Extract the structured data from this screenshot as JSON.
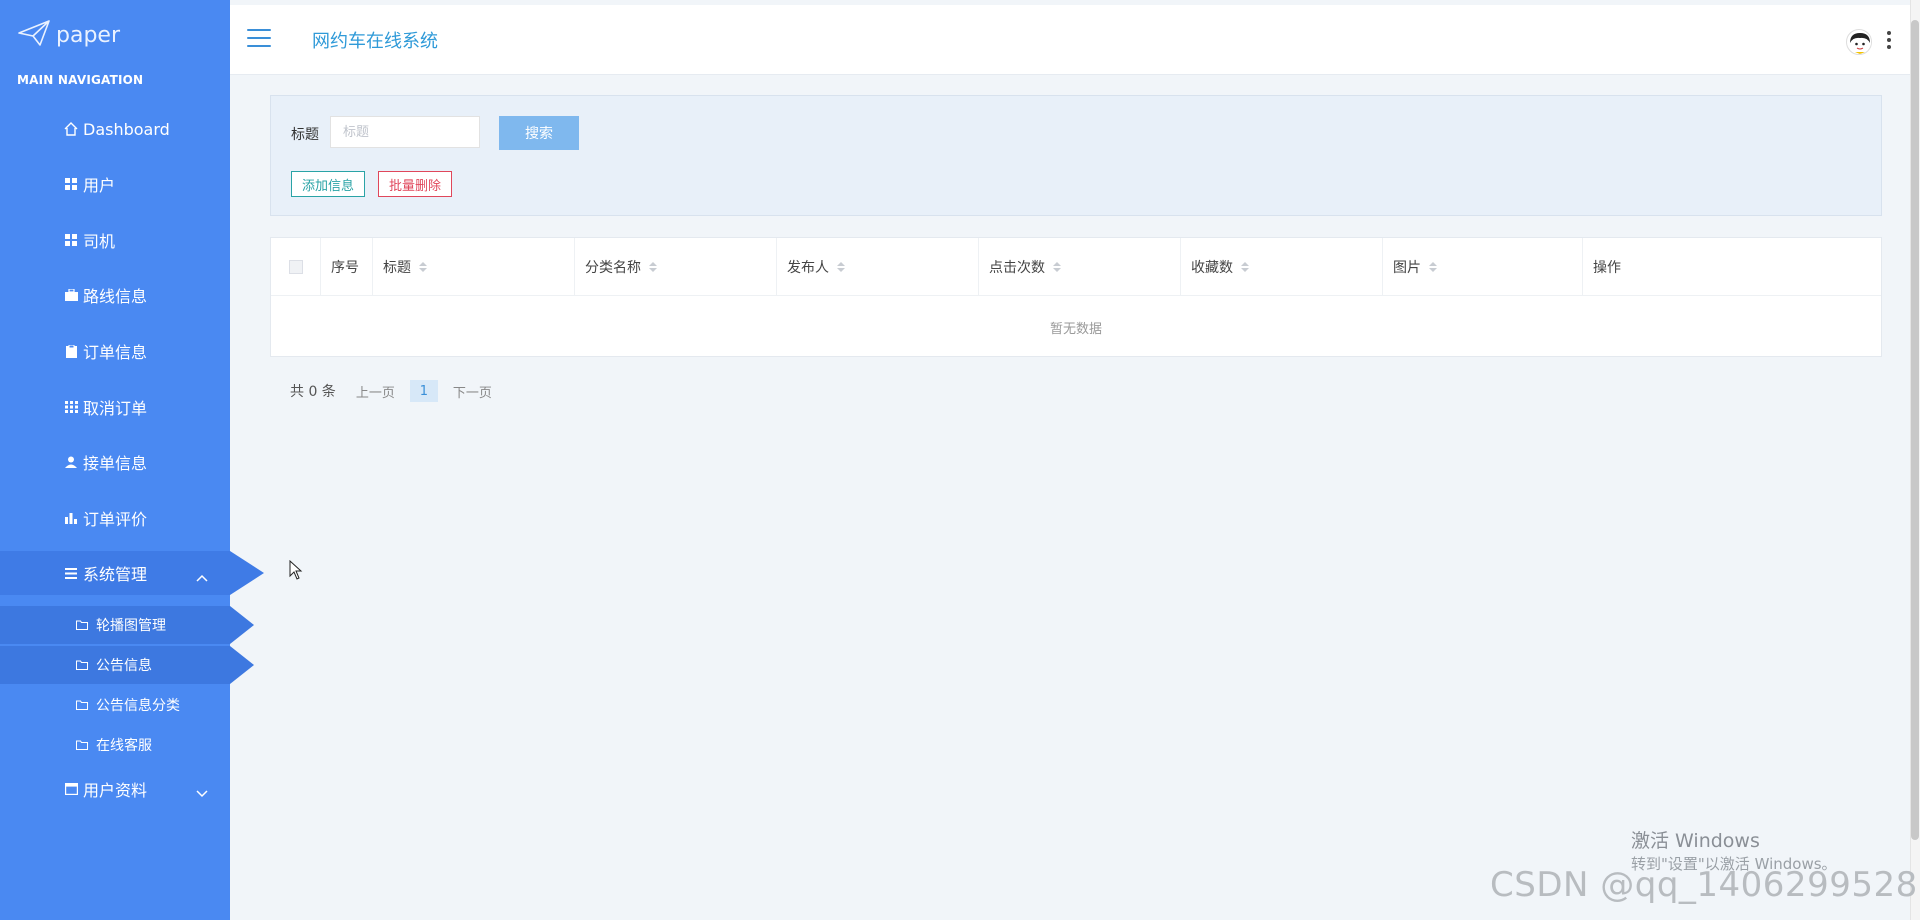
{
  "sidebar": {
    "logo": "paper",
    "section_title": "MAIN NAVIGATION",
    "items": [
      {
        "label": "Dashboard",
        "icon": "home-icon"
      },
      {
        "label": "用户",
        "icon": "grid-icon"
      },
      {
        "label": "司机",
        "icon": "grid-icon"
      },
      {
        "label": "路线信息",
        "icon": "briefcase-icon"
      },
      {
        "label": "订单信息",
        "icon": "clipboard-icon"
      },
      {
        "label": "取消订单",
        "icon": "table-icon"
      },
      {
        "label": "接单信息",
        "icon": "user-icon"
      },
      {
        "label": "订单评价",
        "icon": "bar-chart-icon"
      },
      {
        "label": "系统管理",
        "icon": "list-icon",
        "expanded": true
      },
      {
        "label": "用户资料",
        "icon": "calendar-icon",
        "expanded": false
      }
    ],
    "sub_items": [
      {
        "label": "轮播图管理",
        "icon": "folder-icon"
      },
      {
        "label": "公告信息",
        "icon": "folder-icon"
      },
      {
        "label": "公告信息分类",
        "icon": "folder-icon"
      },
      {
        "label": "在线客服",
        "icon": "folder-icon"
      }
    ]
  },
  "header": {
    "title": "网约车在线系统"
  },
  "search": {
    "label": "标题",
    "placeholder": "标题",
    "value": "",
    "search_btn": "搜索",
    "add_btn": "添加信息",
    "batch_delete_btn": "批量删除"
  },
  "table": {
    "columns": [
      "序号",
      "标题",
      "分类名称",
      "发布人",
      "点击次数",
      "收藏数",
      "图片",
      "操作"
    ],
    "rows": [],
    "empty_text": "暂无数据"
  },
  "pagination": {
    "total": "共 0 条",
    "prev": "上一页",
    "current": "1",
    "next": "下一页"
  },
  "watermark": {
    "activate_title": "激活 Windows",
    "activate_sub": "转到\"设置\"以激活 Windows。",
    "csdn": "CSDN @qq_1406299528"
  },
  "colors": {
    "sidebar_bg": "#4a89f2",
    "accent": "#2f9ad8",
    "danger": "#e0475b",
    "success": "#2aa3a6"
  }
}
